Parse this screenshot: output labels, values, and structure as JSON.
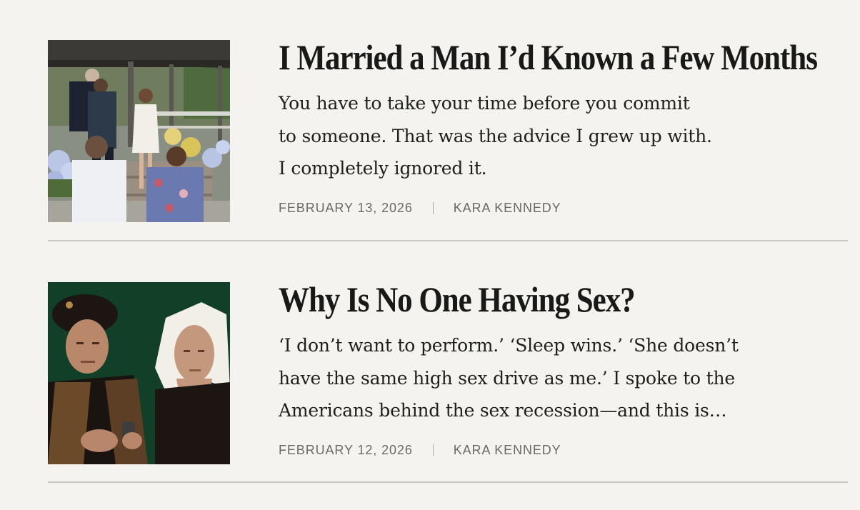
{
  "articles": [
    {
      "headline": "I Married a Man I’d Known a Few Months",
      "dek_lines": [
        "You have to take your time before you commit",
        "to someone. That was the advice I grew up with.",
        "I completely ignored it."
      ],
      "date": "FEBRUARY 13, 2026",
      "author": "KARA KENNEDY",
      "image": "wedding-photo"
    },
    {
      "headline": "Why Is No One Having Sex?",
      "dek_lines": [
        "‘I don’t want to perform.’ ‘Sleep wins.’ ‘She doesn’t",
        "have the same high sex drive as me.’ I spoke to the",
        "Americans behind the sex recession—and this is…"
      ],
      "date": "FEBRUARY 12, 2026",
      "author": "KARA KENNEDY",
      "image": "renaissance-portrait-painting"
    }
  ],
  "colors": {
    "background": "#f4f3ef",
    "headline": "#191917",
    "meta": "#6a6a66",
    "divider": "#c9c8c3"
  }
}
